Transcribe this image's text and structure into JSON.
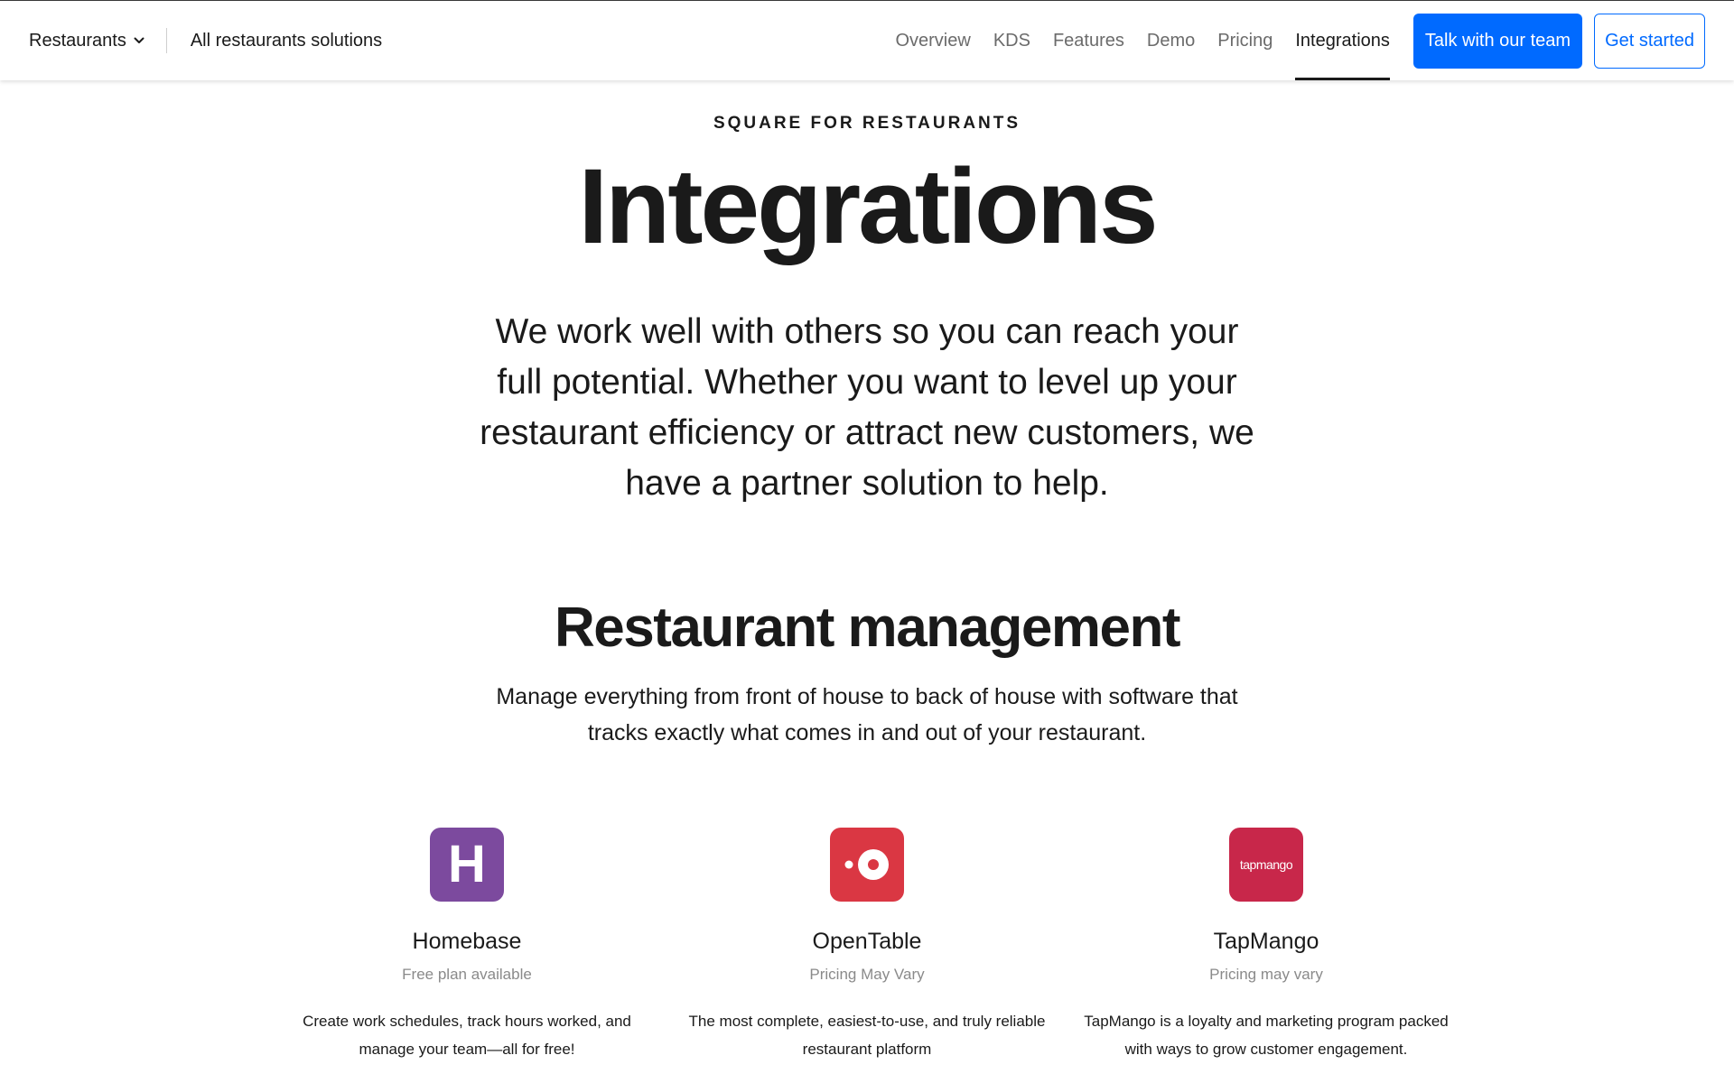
{
  "nav": {
    "brand": "Restaurants",
    "all_solutions": "All restaurants solutions",
    "links": [
      "Overview",
      "KDS",
      "Features",
      "Demo",
      "Pricing",
      "Integrations"
    ],
    "active_link": "Integrations",
    "primary_cta": "Talk with our team",
    "secondary_cta": "Get started"
  },
  "hero": {
    "eyebrow": "SQUARE FOR RESTAURANTS",
    "title": "Integrations",
    "lead": "We work well with others so you can reach your full potential. Whether you want to level up your restaurant efficiency or attract new customers, we have a partner solution to help."
  },
  "section": {
    "title": "Restaurant management",
    "description": "Manage everything from front of house to back of house with software that tracks exactly what comes in and out of your restaurant."
  },
  "cards": [
    {
      "name": "Homebase",
      "price": "Free plan available",
      "description": "Create work schedules, track hours worked, and manage your team—all for free!",
      "logo_letter": "H",
      "logo_color": "#7c4a9e",
      "icon": "homebase-logo"
    },
    {
      "name": "OpenTable",
      "price": "Pricing May Vary",
      "description": "The most complete, easiest-to-use, and truly reliable restaurant platform",
      "logo_color": "#da3743",
      "icon": "opentable-logo"
    },
    {
      "name": "TapMango",
      "price": "Pricing may vary",
      "description": "TapMango is a loyalty and marketing program packed with ways to grow customer engagement.",
      "logo_text": "tapmango",
      "logo_color": "#c8274a",
      "icon": "tapmango-logo"
    }
  ],
  "colors": {
    "accent": "#006aff",
    "text": "#1a1a1a",
    "muted": "#6b6b6b"
  }
}
